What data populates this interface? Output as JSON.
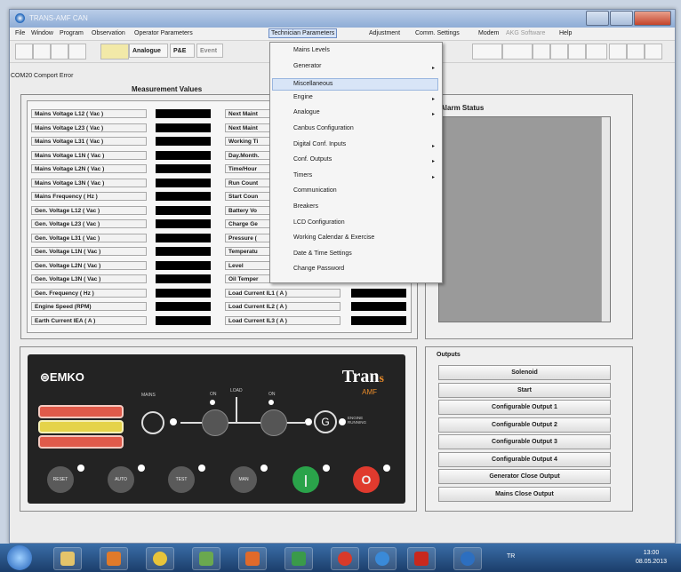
{
  "window": {
    "title": "TRANS-AMF CAN"
  },
  "menubar": [
    "File",
    "Window",
    "Program",
    "Observation",
    "Operator Parameters",
    "Technician Parameters",
    "Adjustment",
    "Comm. Settings",
    "Modem",
    "AKG Software",
    "Help"
  ],
  "toolbar": {
    "analogue_label": "Analogue",
    "plc_label": "P&E",
    "next_label": "Event"
  },
  "status": {
    "port_text": "COM20  Comport Error"
  },
  "measurement": {
    "title": "Measurement Values",
    "left_labels": [
      "Mains Voltage L12 ( Vac )",
      "Mains Voltage L23 ( Vac )",
      "Mains Voltage L31 ( Vac )",
      "Mains Voltage L1N ( Vac )",
      "Mains Voltage L2N ( Vac )",
      "Mains Voltage L3N ( Vac )",
      "Mains Frequency ( Hz )",
      "Gen. Voltage L12 ( Vac )",
      "Gen. Voltage L23 ( Vac )",
      "Gen. Voltage L31 ( Vac )",
      "Gen. Voltage L1N ( Vac )",
      "Gen. Voltage L2N ( Vac )",
      "Gen. Voltage L3N ( Vac )",
      "Gen. Frequency ( Hz )",
      "Engine Speed (RPM)",
      "Earth Current IEA ( A )"
    ],
    "right_labels": [
      "Next Maint",
      "Next Maint",
      "Working Ti",
      "Day.Month.",
      "Time/Hour",
      "Run Count",
      "Start Coun",
      "Battery Vo",
      "Charge Ge",
      "Pressure (",
      "Temperatu",
      "Level",
      "Oil Temper",
      "Load Current IL1 ( A )",
      "Load Current IL2 ( A )",
      "Load Current IL3 ( A )"
    ]
  },
  "alarm": {
    "title": "Alarm Status"
  },
  "device": {
    "brand": "EMKO",
    "product": "Tran",
    "product_sub": "s",
    "product_line2": "AMF",
    "labels": {
      "mains": "MAINS",
      "load": "LOAD",
      "on1": "ON",
      "on2": "ON",
      "engine": "ENGINE RUNNING"
    },
    "buttons": [
      "RESET",
      "AUTO",
      "TEST",
      "MAN"
    ]
  },
  "outputs": {
    "title": "Outputs",
    "items": [
      "Solenoid",
      "Start",
      "Configurable Output 1",
      "Configurable Output 2",
      "Configurable Output 3",
      "Configurable Output 4",
      "Generator Close Output",
      "Mains Close Output"
    ]
  },
  "dropdown": {
    "items": [
      {
        "label": "Mains Levels",
        "submenu": false
      },
      {
        "label": "Generator",
        "submenu": true
      },
      {
        "label": "Miscellaneous",
        "submenu": false
      },
      {
        "label": "Engine",
        "submenu": true
      },
      {
        "label": "Analogue",
        "submenu": true
      },
      {
        "label": "Canbus Configuration",
        "submenu": false
      },
      {
        "label": "Digital Conf. Inputs",
        "submenu": true
      },
      {
        "label": "Conf. Outputs",
        "submenu": true
      },
      {
        "label": "Timers",
        "submenu": true
      },
      {
        "label": "Communication",
        "submenu": false
      },
      {
        "label": "Breakers",
        "submenu": false
      },
      {
        "label": "LCD Configuration",
        "submenu": false
      },
      {
        "label": "Working Calendar & Exercise",
        "submenu": false
      },
      {
        "label": "Date & Time Settings",
        "submenu": false
      },
      {
        "label": "Change Password",
        "submenu": false
      }
    ],
    "highlighted_index": 2
  },
  "taskbar": {
    "time": "13:00",
    "date": "08.05.2013",
    "lang": "TR"
  },
  "colors": {
    "alarm_bg": "#9a9a9a",
    "lamp_red": "#e05a4a",
    "lamp_yellow": "#e5d34a",
    "start_green": "#2aa34a",
    "stop_red": "#e03a2e"
  }
}
